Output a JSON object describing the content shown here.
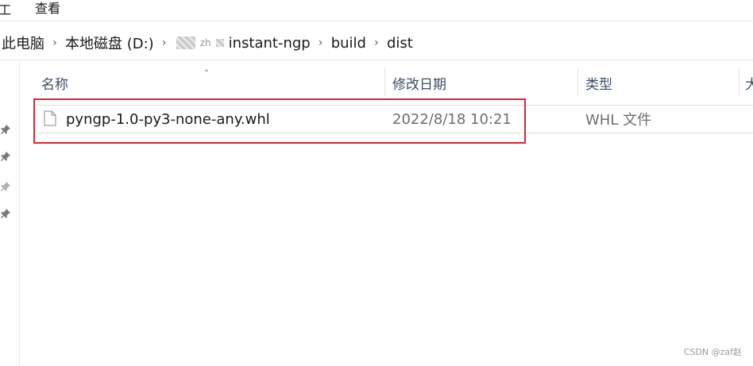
{
  "ribbon": {
    "edge_glyph": "工",
    "view_menu": "查看"
  },
  "address_bar": {
    "crumbs": [
      "此电脑",
      "本地磁盘 (D:)",
      "zh",
      "instant-ngp",
      "build",
      "dist"
    ]
  },
  "columns": {
    "name": "名称",
    "date": "修改日期",
    "type": "类型",
    "size_partial": "大"
  },
  "files": [
    {
      "name": "pyngp-1.0-py3-none-any.whl",
      "date": "2022/8/18 10:21",
      "type": "WHL 文件",
      "icon": "document-icon"
    }
  ],
  "quick_access_icons": [
    "pin-icon",
    "pin-icon",
    "pin-icon",
    "pin-icon"
  ],
  "colors": {
    "highlight": "#d9262f",
    "header_text": "#3d4f66",
    "meta_text": "#6e6e6e"
  },
  "watermark": "CSDN @zaf赵"
}
